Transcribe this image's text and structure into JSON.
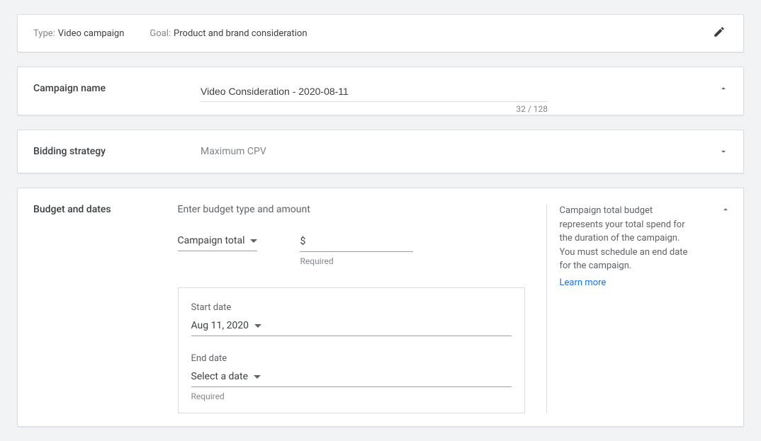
{
  "header": {
    "typeLabel": "Type:",
    "typeValue": "Video campaign",
    "goalLabel": "Goal:",
    "goalValue": "Product and brand consideration"
  },
  "campaignNameSection": {
    "title": "Campaign name",
    "value": "Video Consideration - 2020-08-11",
    "charCount": "32 / 128"
  },
  "biddingSection": {
    "title": "Bidding strategy",
    "value": "Maximum CPV"
  },
  "budgetSection": {
    "title": "Budget and dates",
    "caption": "Enter budget type and amount",
    "budgetType": "Campaign total",
    "currency": "$",
    "requiredText": "Required",
    "startDateLabel": "Start date",
    "startDateValue": "Aug 11, 2020",
    "endDateLabel": "End date",
    "endDateValue": "Select a date",
    "helperText": "Campaign total budget represents your total spend for the duration of the campaign. You must schedule an end date for the campaign.",
    "learnMore": "Learn more"
  }
}
